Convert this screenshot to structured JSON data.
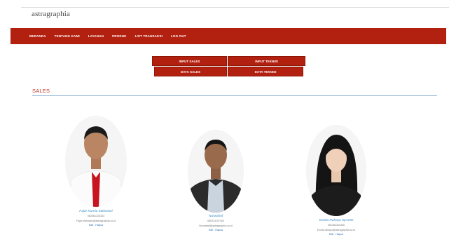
{
  "brand": "astragraphia",
  "nav": [
    "BERANDA",
    "TENTANG KAMI",
    "LAYANAN",
    "PRODUK",
    "LIST TRANSAKSI",
    "LOG OUT"
  ],
  "buttons": {
    "input_sales": "INPUT SALES",
    "input_teknisi": "INPUT TEKNISI",
    "data_sales": "DATA SALES",
    "data_teknisi": "DATA TEKNISI"
  },
  "section_title": "SALES",
  "sales": [
    {
      "name": "Fajar Kurnia Maharani",
      "phone": "082561233333",
      "email": "Fajar.Maharani@astragraphia.co.id",
      "edit": "Edit",
      "delete": "Hapus"
    },
    {
      "name": "Nurwahid",
      "phone": "085314157163",
      "email": "Nurwahid@astragraphia.co.id",
      "edit": "Edit",
      "delete": "Hapus"
    },
    {
      "name": "Ennita Rahayu bp7292",
      "phone": "081364304336",
      "email": "Ennita.rahayu@astragraphia.co.id",
      "edit": "Edit",
      "delete": "Hapus"
    }
  ],
  "colors": {
    "accent": "#b22010",
    "link": "#2a6fb0",
    "name": "#3a8fc9",
    "rule": "#8fb5d6"
  }
}
